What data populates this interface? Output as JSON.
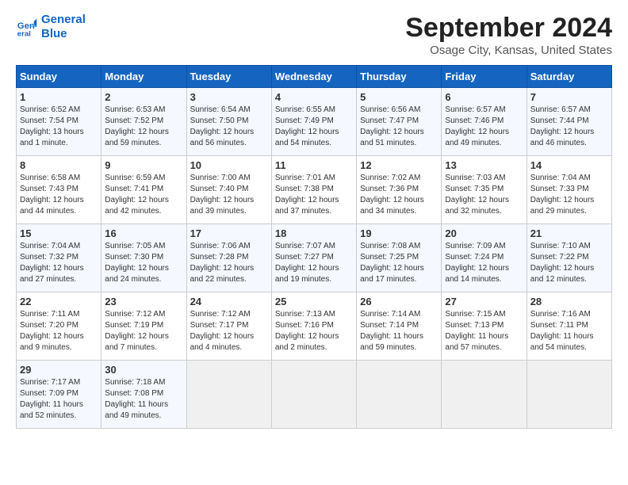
{
  "header": {
    "logo_line1": "General",
    "logo_line2": "Blue",
    "month": "September 2024",
    "location": "Osage City, Kansas, United States"
  },
  "weekdays": [
    "Sunday",
    "Monday",
    "Tuesday",
    "Wednesday",
    "Thursday",
    "Friday",
    "Saturday"
  ],
  "weeks": [
    [
      {
        "day": "1",
        "sunrise": "Sunrise: 6:52 AM",
        "sunset": "Sunset: 7:54 PM",
        "daylight": "Daylight: 13 hours and 1 minute."
      },
      {
        "day": "2",
        "sunrise": "Sunrise: 6:53 AM",
        "sunset": "Sunset: 7:52 PM",
        "daylight": "Daylight: 12 hours and 59 minutes."
      },
      {
        "day": "3",
        "sunrise": "Sunrise: 6:54 AM",
        "sunset": "Sunset: 7:50 PM",
        "daylight": "Daylight: 12 hours and 56 minutes."
      },
      {
        "day": "4",
        "sunrise": "Sunrise: 6:55 AM",
        "sunset": "Sunset: 7:49 PM",
        "daylight": "Daylight: 12 hours and 54 minutes."
      },
      {
        "day": "5",
        "sunrise": "Sunrise: 6:56 AM",
        "sunset": "Sunset: 7:47 PM",
        "daylight": "Daylight: 12 hours and 51 minutes."
      },
      {
        "day": "6",
        "sunrise": "Sunrise: 6:57 AM",
        "sunset": "Sunset: 7:46 PM",
        "daylight": "Daylight: 12 hours and 49 minutes."
      },
      {
        "day": "7",
        "sunrise": "Sunrise: 6:57 AM",
        "sunset": "Sunset: 7:44 PM",
        "daylight": "Daylight: 12 hours and 46 minutes."
      }
    ],
    [
      {
        "day": "8",
        "sunrise": "Sunrise: 6:58 AM",
        "sunset": "Sunset: 7:43 PM",
        "daylight": "Daylight: 12 hours and 44 minutes."
      },
      {
        "day": "9",
        "sunrise": "Sunrise: 6:59 AM",
        "sunset": "Sunset: 7:41 PM",
        "daylight": "Daylight: 12 hours and 42 minutes."
      },
      {
        "day": "10",
        "sunrise": "Sunrise: 7:00 AM",
        "sunset": "Sunset: 7:40 PM",
        "daylight": "Daylight: 12 hours and 39 minutes."
      },
      {
        "day": "11",
        "sunrise": "Sunrise: 7:01 AM",
        "sunset": "Sunset: 7:38 PM",
        "daylight": "Daylight: 12 hours and 37 minutes."
      },
      {
        "day": "12",
        "sunrise": "Sunrise: 7:02 AM",
        "sunset": "Sunset: 7:36 PM",
        "daylight": "Daylight: 12 hours and 34 minutes."
      },
      {
        "day": "13",
        "sunrise": "Sunrise: 7:03 AM",
        "sunset": "Sunset: 7:35 PM",
        "daylight": "Daylight: 12 hours and 32 minutes."
      },
      {
        "day": "14",
        "sunrise": "Sunrise: 7:04 AM",
        "sunset": "Sunset: 7:33 PM",
        "daylight": "Daylight: 12 hours and 29 minutes."
      }
    ],
    [
      {
        "day": "15",
        "sunrise": "Sunrise: 7:04 AM",
        "sunset": "Sunset: 7:32 PM",
        "daylight": "Daylight: 12 hours and 27 minutes."
      },
      {
        "day": "16",
        "sunrise": "Sunrise: 7:05 AM",
        "sunset": "Sunset: 7:30 PM",
        "daylight": "Daylight: 12 hours and 24 minutes."
      },
      {
        "day": "17",
        "sunrise": "Sunrise: 7:06 AM",
        "sunset": "Sunset: 7:28 PM",
        "daylight": "Daylight: 12 hours and 22 minutes."
      },
      {
        "day": "18",
        "sunrise": "Sunrise: 7:07 AM",
        "sunset": "Sunset: 7:27 PM",
        "daylight": "Daylight: 12 hours and 19 minutes."
      },
      {
        "day": "19",
        "sunrise": "Sunrise: 7:08 AM",
        "sunset": "Sunset: 7:25 PM",
        "daylight": "Daylight: 12 hours and 17 minutes."
      },
      {
        "day": "20",
        "sunrise": "Sunrise: 7:09 AM",
        "sunset": "Sunset: 7:24 PM",
        "daylight": "Daylight: 12 hours and 14 minutes."
      },
      {
        "day": "21",
        "sunrise": "Sunrise: 7:10 AM",
        "sunset": "Sunset: 7:22 PM",
        "daylight": "Daylight: 12 hours and 12 minutes."
      }
    ],
    [
      {
        "day": "22",
        "sunrise": "Sunrise: 7:11 AM",
        "sunset": "Sunset: 7:20 PM",
        "daylight": "Daylight: 12 hours and 9 minutes."
      },
      {
        "day": "23",
        "sunrise": "Sunrise: 7:12 AM",
        "sunset": "Sunset: 7:19 PM",
        "daylight": "Daylight: 12 hours and 7 minutes."
      },
      {
        "day": "24",
        "sunrise": "Sunrise: 7:12 AM",
        "sunset": "Sunset: 7:17 PM",
        "daylight": "Daylight: 12 hours and 4 minutes."
      },
      {
        "day": "25",
        "sunrise": "Sunrise: 7:13 AM",
        "sunset": "Sunset: 7:16 PM",
        "daylight": "Daylight: 12 hours and 2 minutes."
      },
      {
        "day": "26",
        "sunrise": "Sunrise: 7:14 AM",
        "sunset": "Sunset: 7:14 PM",
        "daylight": "Daylight: 11 hours and 59 minutes."
      },
      {
        "day": "27",
        "sunrise": "Sunrise: 7:15 AM",
        "sunset": "Sunset: 7:13 PM",
        "daylight": "Daylight: 11 hours and 57 minutes."
      },
      {
        "day": "28",
        "sunrise": "Sunrise: 7:16 AM",
        "sunset": "Sunset: 7:11 PM",
        "daylight": "Daylight: 11 hours and 54 minutes."
      }
    ],
    [
      {
        "day": "29",
        "sunrise": "Sunrise: 7:17 AM",
        "sunset": "Sunset: 7:09 PM",
        "daylight": "Daylight: 11 hours and 52 minutes."
      },
      {
        "day": "30",
        "sunrise": "Sunrise: 7:18 AM",
        "sunset": "Sunset: 7:08 PM",
        "daylight": "Daylight: 11 hours and 49 minutes."
      },
      null,
      null,
      null,
      null,
      null
    ]
  ]
}
